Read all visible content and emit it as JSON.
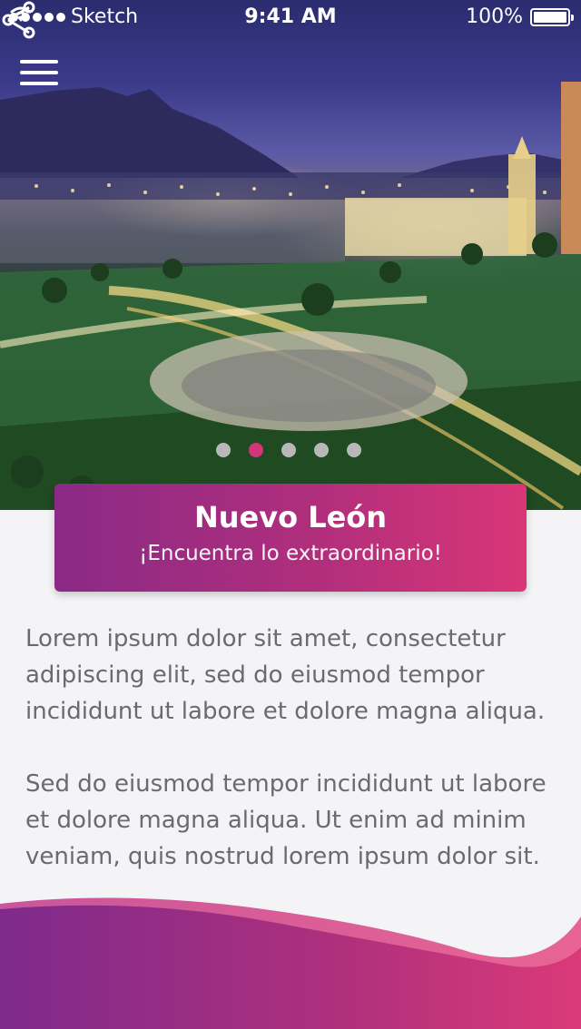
{
  "status_bar": {
    "carrier": "Sketch",
    "time": "9:41 AM",
    "battery": "100%"
  },
  "hero": {
    "image": "city-night-photo",
    "carousel_pages": 5,
    "active_page": 2
  },
  "icons": {
    "menu": "hamburger-menu-icon",
    "share": "share-icon",
    "wifi": "wifi-icon",
    "battery": "battery-icon"
  },
  "title_card": {
    "title": "Nuevo León",
    "subtitle": "¡Encuentra lo extraordinario!"
  },
  "body": {
    "paragraph1": "Lorem ipsum dolor sit amet, consectetur adipiscing elit, sed do eiusmod tempor incididunt ut labore et dolore magna aliqua.",
    "paragraph2": "Sed do eiusmod tempor incididunt ut labore et dolore magna aliqua. Ut enim ad minim veniam, quis nostrud lorem ipsum dolor sit."
  },
  "colors": {
    "accent_start": "#8a2a86",
    "accent_end": "#d93677",
    "active_dot": "#d63478",
    "inactive_dot": "#b8b8b8"
  }
}
